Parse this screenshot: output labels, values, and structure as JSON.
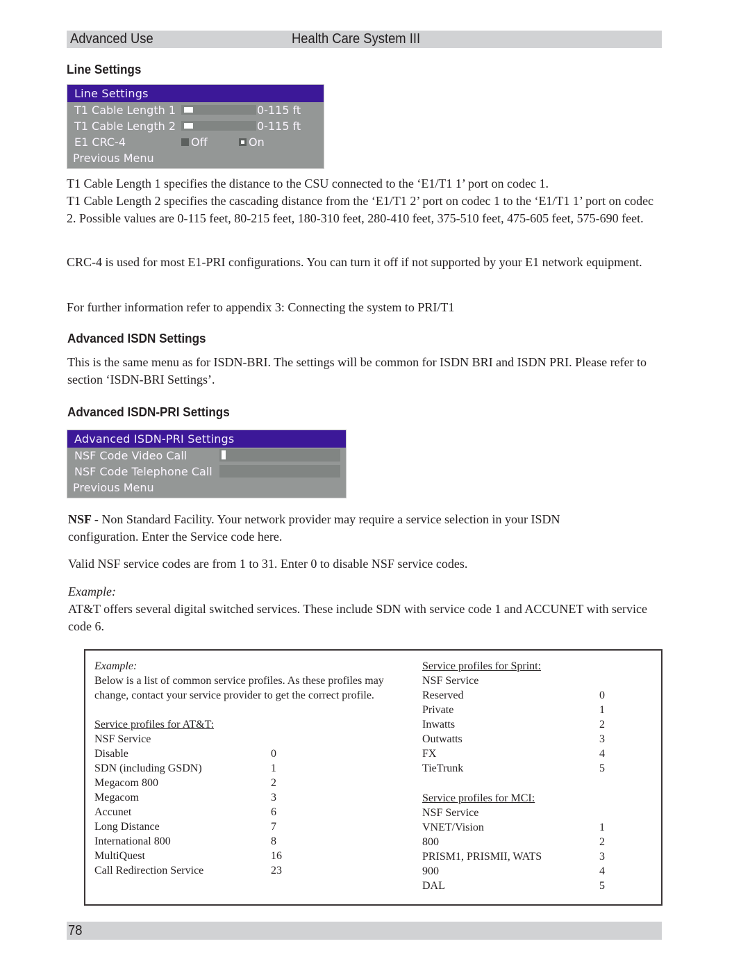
{
  "header": {
    "section": "Advanced Use",
    "title": "Health Care System III"
  },
  "line_settings": {
    "heading": "Line Settings",
    "menu": {
      "title": "Line Settings",
      "rows": [
        {
          "label": "T1 Cable Length 1",
          "value": "0-115 ft",
          "slider_fraction": 0.0
        },
        {
          "label": "T1 Cable Length 2",
          "value": "0-115 ft",
          "slider_fraction": 0.0
        }
      ],
      "crc": {
        "label": "E1 CRC-4",
        "options": [
          "Off",
          "On"
        ],
        "selected": "On"
      },
      "previous": "Previous Menu"
    },
    "paragraphs": [
      "T1 Cable Length 1 specifies the distance to the CSU connected to the ‘E1/T1 1’ port on codec 1.",
      "T1 Cable Length 2 specifies the cascading distance from the ‘E1/T1 2’ port on codec 1 to the ‘E1/T1 1’ port on codec 2. Possible values are 0-115 feet, 80-215 feet, 180-310 feet, 280-410 feet, 375-510 feet, 475-605 feet, 575-690 feet.",
      "CRC-4 is used for most E1-PRI configurations. You can turn it off if not supported by your E1 network equipment.",
      "For further information refer to appendix 3: Connecting the system to PRI/T1"
    ]
  },
  "advanced_isdn": {
    "heading": "Advanced ISDN Settings",
    "paragraph": "This is the same menu as for ISDN-BRI. The settings will be common for ISDN BRI and ISDN PRI. Please refer to section ‘ISDN-BRI Settings’."
  },
  "advanced_isdn_pri": {
    "heading": "Advanced ISDN-PRI Settings",
    "menu": {
      "title": "Advanced ISDN-PRI Settings",
      "rows": [
        {
          "label": "NSF Code Video Call",
          "value": ""
        },
        {
          "label": "NSF Code Telephone Call",
          "value": ""
        }
      ],
      "previous": "Previous Menu"
    },
    "nsf_bold": "NSF -",
    "nsf_text": " Non Standard Facility. Your network provider may require a service selection in your ISDN configuration. Enter the Service code here.",
    "valid_text": "Valid NSF service codes are from 1 to 31. Enter 0 to disable NSF service codes.",
    "example_label": "Example:",
    "example_text": "AT&T offers several digital switched services. These include SDN with service code 1 and ACCUNET with service code 6."
  },
  "example_box": {
    "label": "Example:",
    "intro_line1": "Below is a list of common service profiles. As these profiles may",
    "intro_line2": "change, contact your service provider to get the correct profile.",
    "att": {
      "heading": "Service profiles for AT&T:",
      "subheading": "NSF Service",
      "rows": [
        {
          "name": "Disable",
          "code": "0"
        },
        {
          "name": "SDN (including GSDN)",
          "code": "1"
        },
        {
          "name": "Megacom 800",
          "code": "2"
        },
        {
          "name": "Megacom",
          "code": "3"
        },
        {
          "name": "Accunet",
          "code": "6"
        },
        {
          "name": "Long Distance",
          "code": "7"
        },
        {
          "name": "International 800",
          "code": "8"
        },
        {
          "name": "MultiQuest",
          "code": "16"
        },
        {
          "name": "Call Redirection Service",
          "code": "23"
        }
      ]
    },
    "sprint": {
      "heading": "Service profiles for Sprint:",
      "subheading": "NSF Service",
      "rows": [
        {
          "name": "Reserved",
          "code": "0"
        },
        {
          "name": "Private",
          "code": "1"
        },
        {
          "name": "Inwatts",
          "code": "2"
        },
        {
          "name": "Outwatts",
          "code": "3"
        },
        {
          "name": "FX",
          "code": "4"
        },
        {
          "name": "TieTrunk",
          "code": "5"
        }
      ]
    },
    "mci": {
      "heading": "Service profiles for MCI:",
      "subheading": "NSF Service",
      "rows": [
        {
          "name": "VNET/Vision",
          "code": "1"
        },
        {
          "name": "800",
          "code": "2"
        },
        {
          "name": "PRISM1, PRISMII, WATS",
          "code": "3"
        },
        {
          "name": "900",
          "code": "4"
        },
        {
          "name": "DAL",
          "code": "5"
        }
      ]
    }
  },
  "footer": {
    "page_number": "78"
  }
}
